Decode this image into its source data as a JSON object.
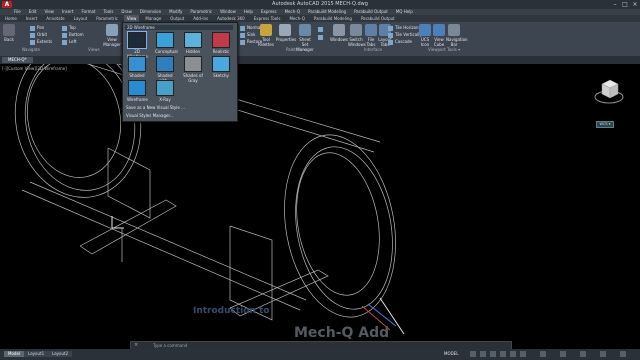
{
  "title": "Autodesk AutoCAD 2015    MECH-Q.dwg",
  "search_placeholder": "Type a keyword or phrase",
  "menubar": [
    "File",
    "Edit",
    "View",
    "Insert",
    "Format",
    "Tools",
    "Draw",
    "Dimension",
    "Modify",
    "Parametric",
    "Window",
    "Help",
    "Express",
    "Mech-Q",
    "Parabuild Modeling",
    "Parabuild Output",
    "MQ Help"
  ],
  "ribbon_tabs": [
    "Home",
    "Insert",
    "Annotate",
    "Layout",
    "Parametric",
    "View",
    "Manage",
    "Output",
    "Add-ins",
    "Autodesk 360",
    "Express Tools",
    "Mech-Q",
    "Parabuild Modeling",
    "Parabuild Output"
  ],
  "active_tab": "View",
  "ribbon": {
    "back": "Back",
    "orbit": "Orbit",
    "pan": "Pan",
    "extents": "Extents",
    "top": "Top",
    "bottom": "Bottom",
    "left": "Left",
    "view_manager": "View Manager",
    "normal": "Normal",
    "sw": "Sink",
    "restore": "Restore",
    "tool_palettes": "Tool Palettes",
    "properties": "Properties",
    "sheet_set_manager": "Sheet Set Manager",
    "windows": "Windows",
    "switch_windows": "Switch Windows",
    "file_tabs": "File Tabs",
    "layout_tabs": "Layout Tabs",
    "tile_h": "Tile Horizontally",
    "tile_v": "Tile Vertically",
    "cascade": "Cascade",
    "ucs_icon": "UCS Icon",
    "view_cube": "View Cube",
    "nav_bar": "Navigation Bar",
    "panel_navigate": "Navigate",
    "panel_views": "Views",
    "panel_palettes": "Palettes ▾",
    "panel_interface": "Interface",
    "panel_viewport_tools": "Viewport Tools ▾"
  },
  "doc_tab": "MECH-Q*",
  "viewport_label": "[-][Custom View][2D Wireframe]",
  "visual_styles": {
    "current": "2D Wireframe",
    "items": [
      {
        "label": "2D Wireframe",
        "color": "#1e2a3a"
      },
      {
        "label": "Conceptual",
        "color": "#3aa0d8"
      },
      {
        "label": "Hidden",
        "color": "#5bb0dc"
      },
      {
        "label": "Realistic",
        "color": "#c23a4a"
      },
      {
        "label": "Shaded",
        "color": "#3890d0"
      },
      {
        "label": "Shaded with...",
        "color": "#2f7fc0"
      },
      {
        "label": "Shades of Gray",
        "color": "#8a8f96"
      },
      {
        "label": "Sketchy",
        "color": "#4aa8e0"
      },
      {
        "label": "Wireframe",
        "color": "#2a8cd0"
      },
      {
        "label": "X-Ray",
        "color": "#48a0c8"
      }
    ],
    "save": "Save as a New Visual Style ...",
    "manager": "Visual Styles Manager..."
  },
  "wcs": "WCS ▾",
  "overlay_intro": "Introduction to",
  "overlay_brand": "Mech-Q Add",
  "cmd_placeholder": "Type a command",
  "layout_tabs": [
    "Model",
    "Layout1",
    "Layout2"
  ],
  "model_label": "MODEL"
}
